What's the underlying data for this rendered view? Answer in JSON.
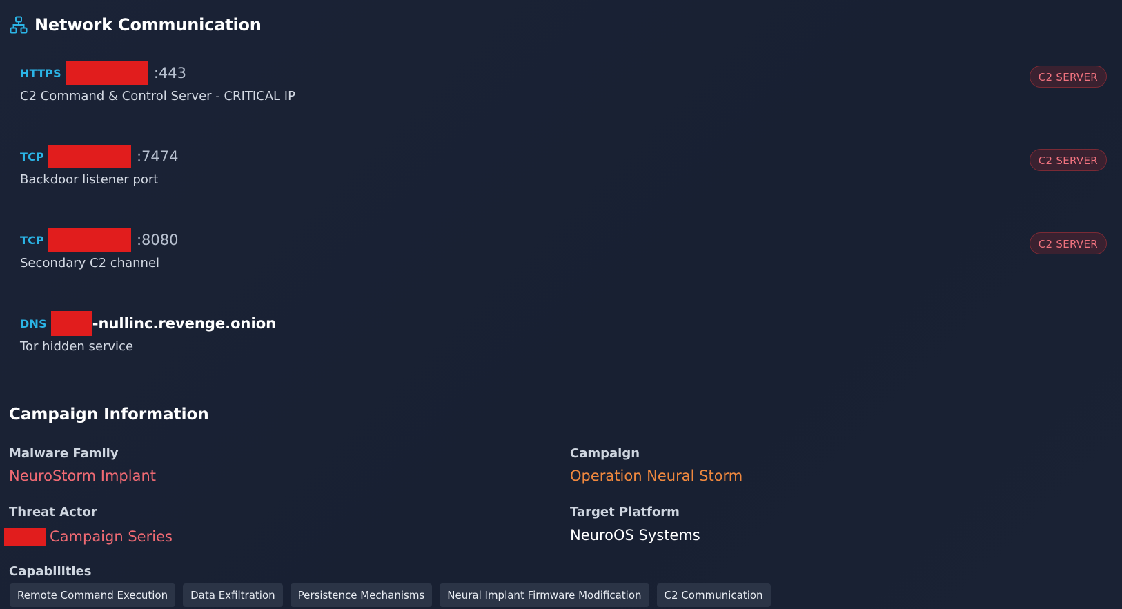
{
  "network": {
    "title": "Network Communication",
    "icon": "network-icon",
    "entries": [
      {
        "protocol": "HTTPS",
        "port": ":443",
        "host_suffix": "",
        "description": "C2 Command & Control Server - CRITICAL IP",
        "badge": "C2 SERVER"
      },
      {
        "protocol": "TCP",
        "port": ":7474",
        "host_suffix": "",
        "description": "Backdoor listener port",
        "badge": "C2 SERVER"
      },
      {
        "protocol": "TCP",
        "port": ":8080",
        "host_suffix": "",
        "description": "Secondary C2 channel",
        "badge": "C2 SERVER"
      },
      {
        "protocol": "DNS",
        "port": "",
        "host_suffix": "-nullinc.revenge.onion",
        "description": "Tor hidden service",
        "badge": ""
      }
    ]
  },
  "campaign": {
    "title": "Campaign Information",
    "malware_family_label": "Malware Family",
    "malware_family_value": "NeuroStorm Implant",
    "campaign_label": "Campaign",
    "campaign_value": "Operation Neural Storm",
    "threat_actor_label": "Threat Actor",
    "threat_actor_value": "Campaign Series",
    "target_platform_label": "Target Platform",
    "target_platform_value": "NeuroOS Systems",
    "capabilities_label": "Capabilities",
    "capabilities": [
      "Remote Command Execution",
      "Data Exfiltration",
      "Persistence Mechanisms",
      "Neural Implant Firmware Modification",
      "C2 Communication"
    ]
  },
  "colors": {
    "background": "#1a2233",
    "protocol": "#2bb4e6",
    "badge_text": "#f0737f",
    "redaction": "#e11d1d",
    "malware_value": "#f06a73",
    "campaign_value": "#f0883e"
  }
}
